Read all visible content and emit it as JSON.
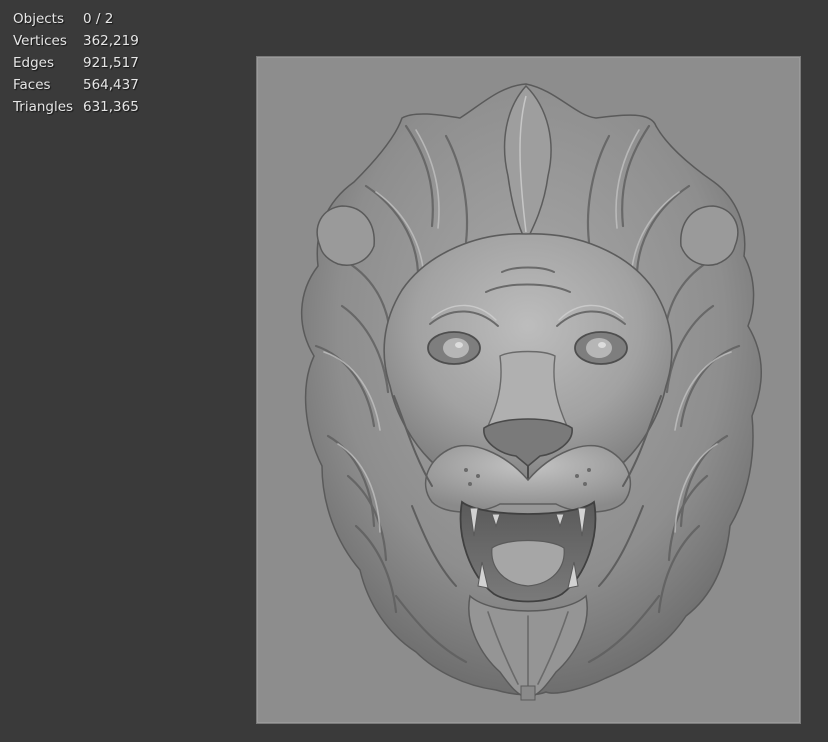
{
  "stats": {
    "objects": {
      "label": "Objects",
      "value": "0 / 2"
    },
    "vertices": {
      "label": "Vertices",
      "value": "362,219"
    },
    "edges": {
      "label": "Edges",
      "value": "921,517"
    },
    "faces": {
      "label": "Faces",
      "value": "564,437"
    },
    "triangles": {
      "label": "Triangles",
      "value": "631,365"
    }
  },
  "colors": {
    "viewport_bg": "#3a3a3a",
    "plate": "#8d8d8d",
    "sculpt_light": "#b4b4b4",
    "sculpt_mid": "#8a8a8a",
    "sculpt_dark": "#4e4e4e",
    "overlay_text": "#e6e6e6"
  },
  "scene": {
    "object_icon": "lion-head-relief-icon"
  }
}
